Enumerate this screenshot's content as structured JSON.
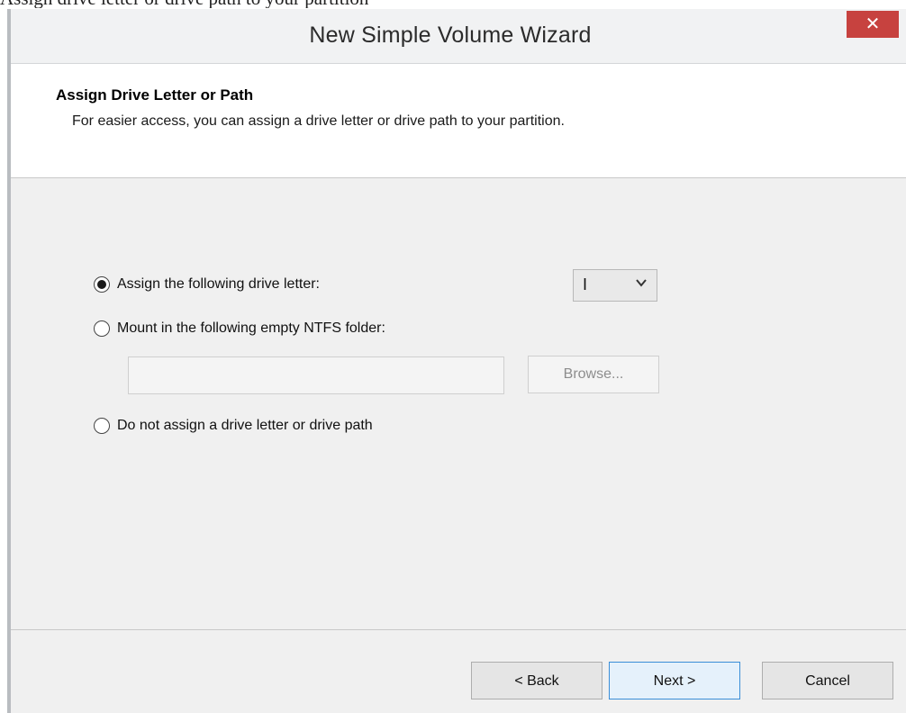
{
  "background_text": "Assign drive letter or drive path to your partition",
  "window": {
    "title": "New Simple Volume Wizard",
    "close_glyph": "✕"
  },
  "header": {
    "title": "Assign Drive Letter or Path",
    "subtitle": "For easier access, you can assign a drive letter or drive path to your partition."
  },
  "options": {
    "assign_letter": {
      "label": "Assign the following drive letter:",
      "checked": true
    },
    "mount_folder": {
      "label": "Mount in the following empty NTFS folder:",
      "checked": false
    },
    "no_assign": {
      "label": "Do not assign a drive letter or drive path",
      "checked": false
    }
  },
  "drive_letter": {
    "selected": "I"
  },
  "folder_path": {
    "value": "",
    "browse_label": "Browse..."
  },
  "footer": {
    "back_label": "< Back",
    "next_label": "Next >",
    "cancel_label": "Cancel"
  },
  "colors": {
    "close_button": "#c7423f",
    "focus_border": "#3a8ed8"
  },
  "icons": {
    "close": "close-icon",
    "dropdown": "chevron-down-icon"
  }
}
